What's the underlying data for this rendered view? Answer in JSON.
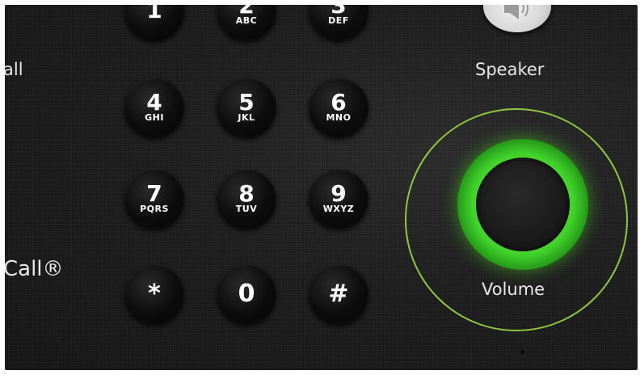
{
  "keypad": {
    "keys": [
      {
        "digit": "1",
        "letters": ""
      },
      {
        "digit": "2",
        "letters": "ABC"
      },
      {
        "digit": "3",
        "letters": "DEF"
      },
      {
        "digit": "4",
        "letters": "GHI"
      },
      {
        "digit": "5",
        "letters": "JKL"
      },
      {
        "digit": "6",
        "letters": "MNO"
      },
      {
        "digit": "7",
        "letters": "PQRS"
      },
      {
        "digit": "8",
        "letters": "TUV"
      },
      {
        "digit": "9",
        "letters": "WXYZ"
      },
      {
        "digit": "*",
        "letters": ""
      },
      {
        "digit": "0",
        "letters": ""
      },
      {
        "digit": "#",
        "letters": ""
      }
    ]
  },
  "labels": {
    "left_partial_top": "all",
    "left_partial_brand": "Call®",
    "speaker": "Speaker",
    "volume": "Volume"
  },
  "icons": {
    "speaker_button": "speaker-icon",
    "volume_knob": "volume-knob-icon"
  },
  "colors": {
    "panel": "#1d1d1d",
    "key": "#0c0c0c",
    "volume_glow": "#3fd12a",
    "highlight_circle": "#8fc63f",
    "speaker_button": "#d8d8d8"
  }
}
